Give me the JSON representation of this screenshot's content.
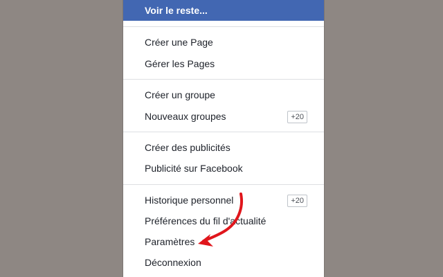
{
  "menu": {
    "see_more_label": "Voir le reste...",
    "sections": [
      {
        "items": [
          {
            "label": "Créer une Page"
          },
          {
            "label": "Gérer les Pages"
          }
        ]
      },
      {
        "items": [
          {
            "label": "Créer un groupe"
          },
          {
            "label": "Nouveaux groupes",
            "badge": "+20"
          }
        ]
      },
      {
        "items": [
          {
            "label": "Créer des publicités"
          },
          {
            "label": "Publicité sur Facebook"
          }
        ]
      },
      {
        "items": [
          {
            "label": "Historique personnel",
            "badge": "+20"
          },
          {
            "label": "Préférences du fil d'actualité"
          },
          {
            "label": "Paramètres"
          },
          {
            "label": "Déconnexion"
          }
        ]
      }
    ]
  },
  "colors": {
    "backdrop": "#8e8783",
    "highlight": "#4267b2",
    "arrow": "#e0161c"
  },
  "annotation": {
    "arrow_target": "Paramètres",
    "arrow_icon": "red-curved-arrow-icon"
  }
}
